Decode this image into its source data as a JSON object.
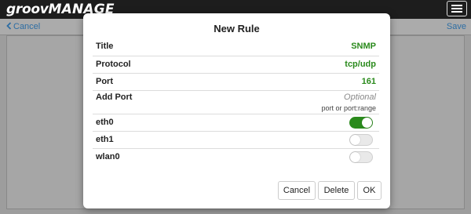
{
  "app": {
    "logo_part1": "groov",
    "logo_part2": "MANAGE"
  },
  "nav": {
    "cancel_label": "Cancel",
    "save_label": "Save"
  },
  "modal": {
    "title": "New Rule",
    "fields": [
      {
        "label": "Title",
        "value": "SNMP"
      },
      {
        "label": "Protocol",
        "value": "tcp/udp"
      },
      {
        "label": "Port",
        "value": "161"
      },
      {
        "label": "Add Port",
        "placeholder": "Optional",
        "hint": "port or port:range"
      }
    ],
    "interfaces": [
      {
        "label": "eth0",
        "enabled": true
      },
      {
        "label": "eth1",
        "enabled": false
      },
      {
        "label": "wlan0",
        "enabled": false
      }
    ],
    "buttons": {
      "cancel": "Cancel",
      "delete": "Delete",
      "ok": "OK"
    }
  },
  "colors": {
    "accent": "#2a8a1c",
    "link": "#2d6da3",
    "topbar": "#1d1d1d"
  },
  "icons": {
    "back": "chevron-left-icon",
    "menu": "hamburger-menu-icon"
  }
}
